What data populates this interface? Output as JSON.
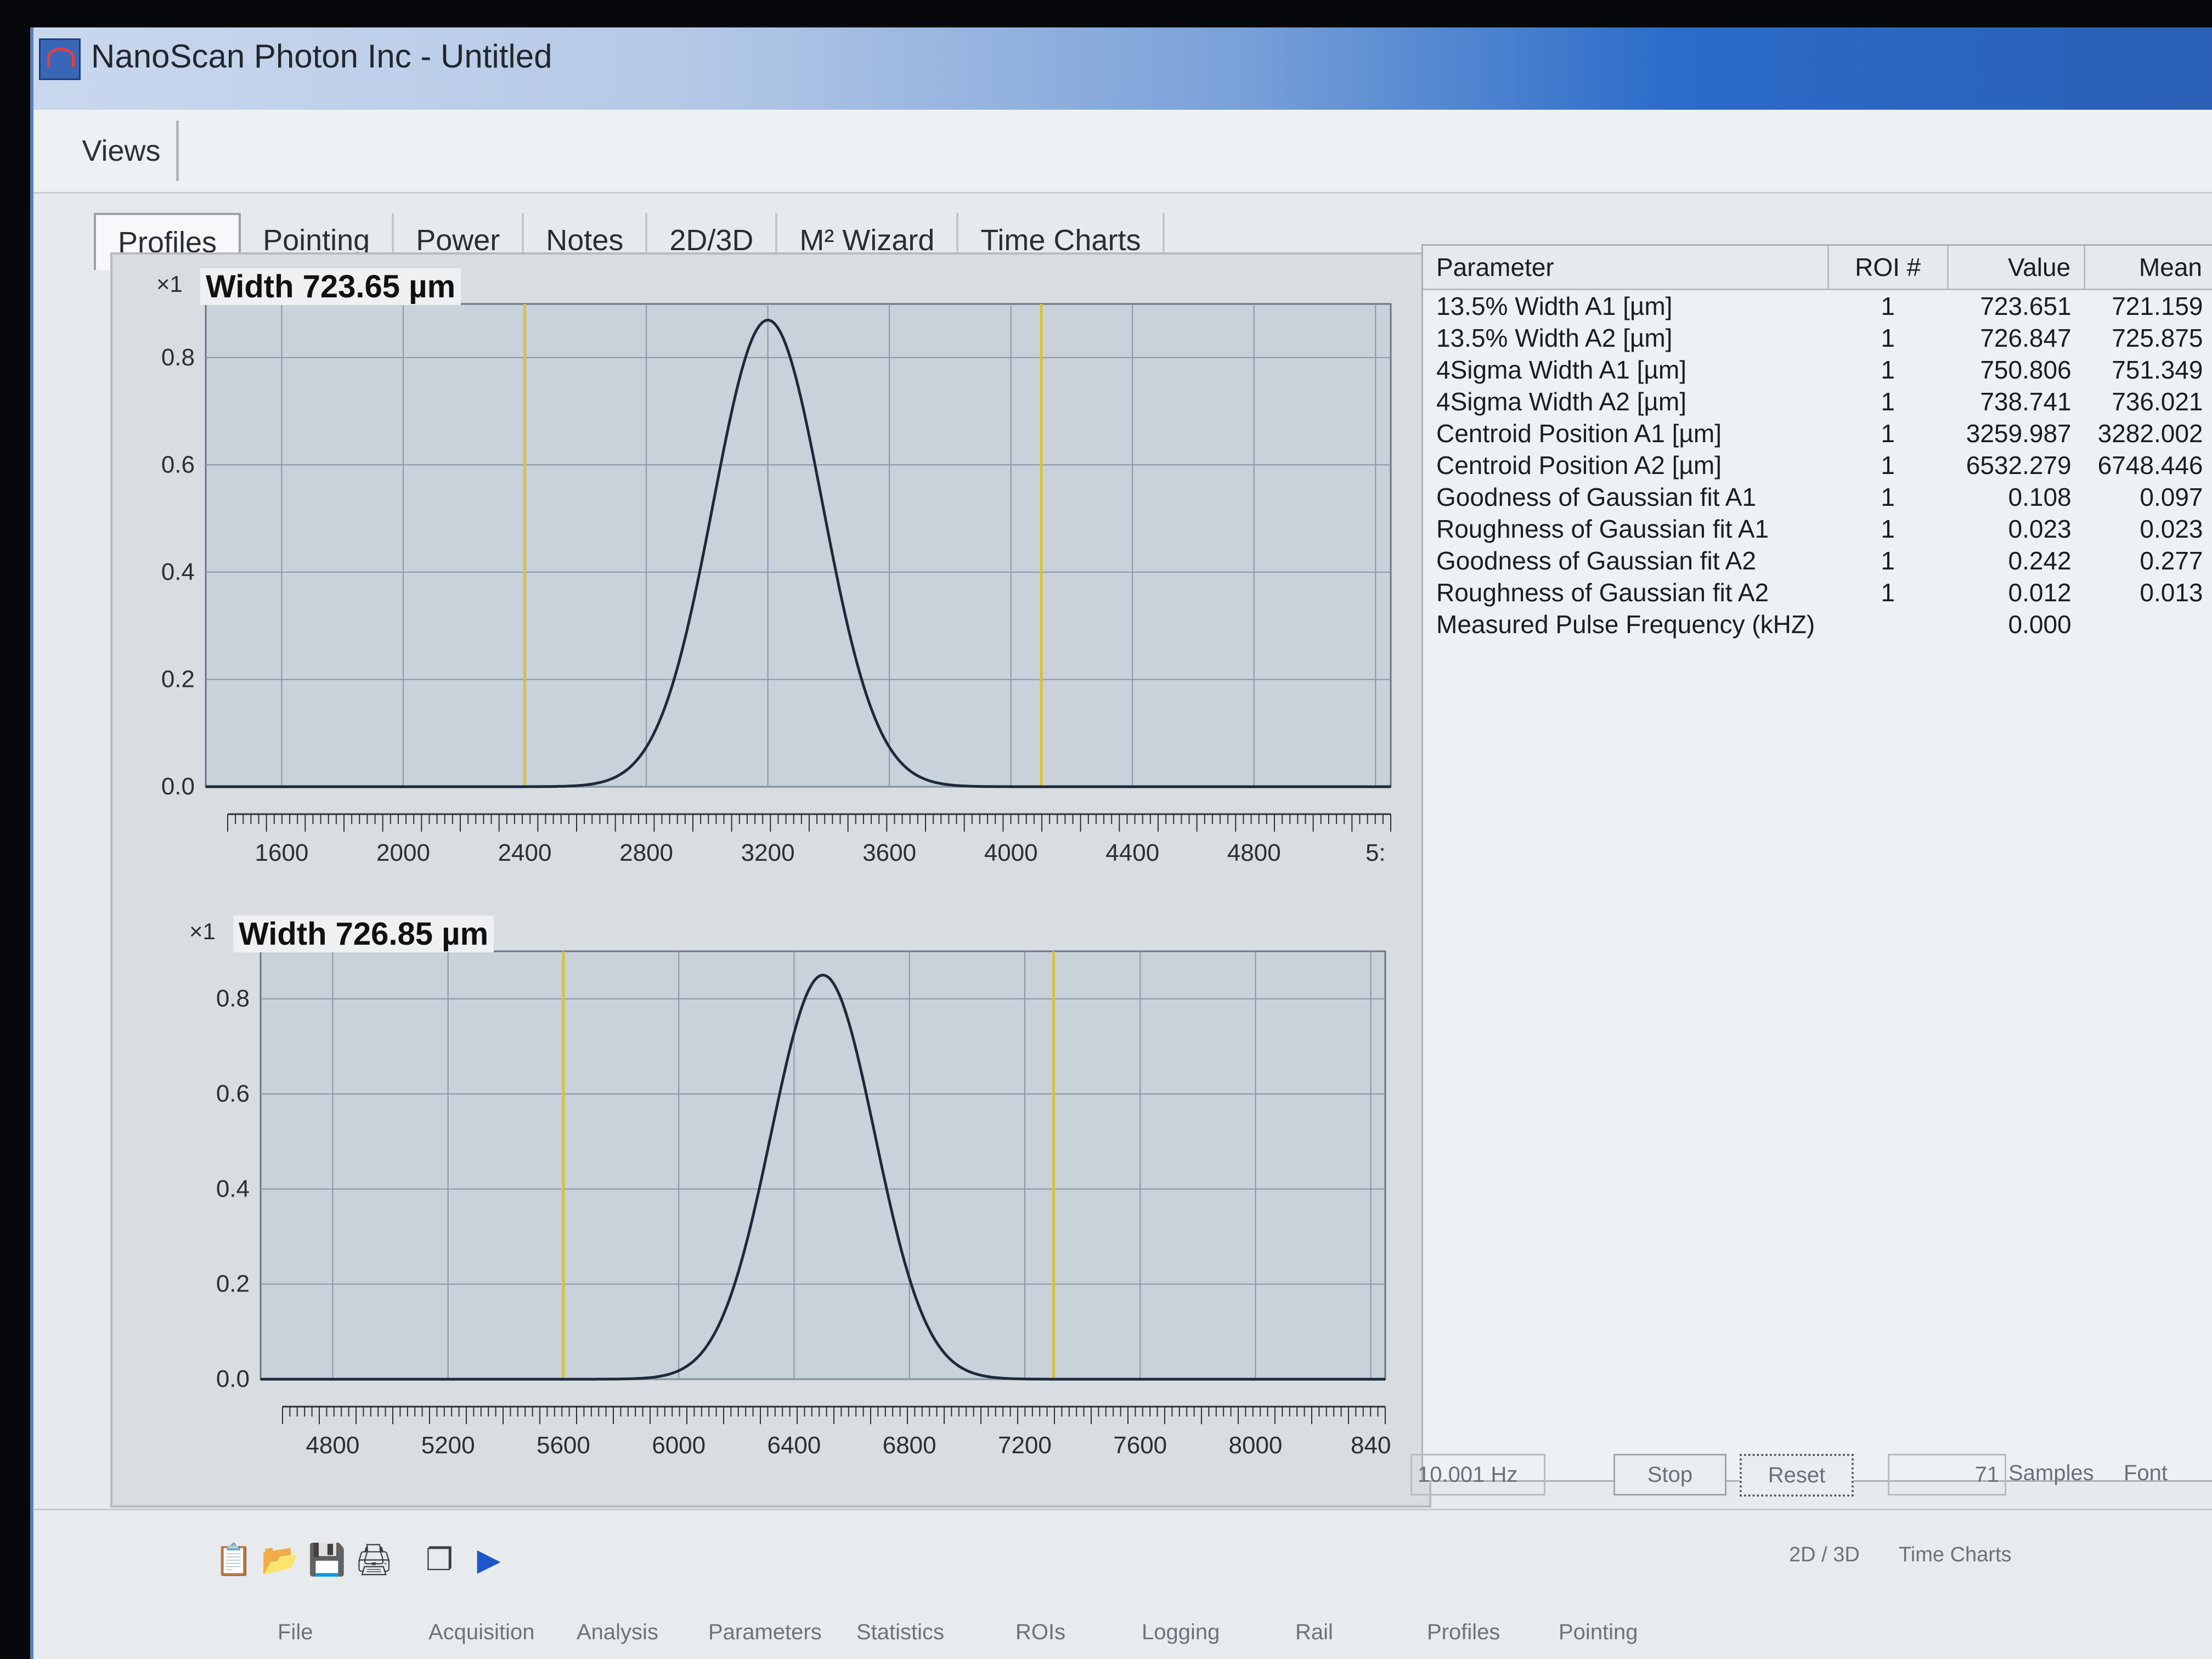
{
  "window": {
    "title": "NanoScan Photon Inc - Untitled"
  },
  "views_tab": "Views",
  "tabs": [
    "Profiles",
    "Pointing",
    "Power",
    "Notes",
    "2D/3D",
    "M² Wizard",
    "Time Charts"
  ],
  "active_tab": "Profiles",
  "params": {
    "headers": [
      "Parameter",
      "ROI #",
      "Value",
      "Mean"
    ],
    "rows": [
      [
        "13.5% Width A1 [µm]",
        "1",
        "723.651",
        "721.159"
      ],
      [
        "13.5% Width A2 [µm]",
        "1",
        "726.847",
        "725.875"
      ],
      [
        "4Sigma Width A1 [µm]",
        "1",
        "750.806",
        "751.349"
      ],
      [
        "4Sigma Width A2 [µm]",
        "1",
        "738.741",
        "736.021"
      ],
      [
        "Centroid Position A1 [µm]",
        "1",
        "3259.987",
        "3282.002"
      ],
      [
        "Centroid Position A2 [µm]",
        "1",
        "6532.279",
        "6748.446"
      ],
      [
        "Goodness of Gaussian fit A1",
        "1",
        "0.108",
        "0.097"
      ],
      [
        "Roughness of Gaussian fit A1",
        "1",
        "0.023",
        "0.023"
      ],
      [
        "Goodness of Gaussian fit A2",
        "1",
        "0.242",
        "0.277"
      ],
      [
        "Roughness of Gaussian fit A2",
        "1",
        "0.012",
        "0.013"
      ],
      [
        "Measured Pulse Frequency (kHZ)",
        "",
        "0.000",
        ""
      ]
    ]
  },
  "status": {
    "rate": "10.001 Hz",
    "stop": "Stop",
    "reset": "Reset",
    "samples": "71",
    "samples_label": "Samples",
    "font": "Font"
  },
  "bottom_tabs": [
    "File",
    "Acquisition",
    "Analysis",
    "Parameters",
    "Statistics",
    "ROIs",
    "Logging",
    "Rail",
    "Profiles",
    "Pointing"
  ],
  "right_tabs": [
    "2D / 3D",
    "Time Charts"
  ],
  "toolbar_icons": [
    "clipboard-icon",
    "open-folder-icon",
    "save-icon",
    "print-icon",
    "copy-window-icon",
    "play-icon"
  ],
  "colors": {
    "accent": "#2a5fb5",
    "curve": "#1d2a3a",
    "marker": "#d8c23a",
    "grid": "#8a96a8"
  },
  "chart_data": [
    {
      "type": "line",
      "scale": "×1",
      "title": "Width 723.65 µm",
      "ylim": [
        0,
        0.9
      ],
      "yticks": [
        "0.8",
        "0.6",
        "0.4",
        "0.2",
        "0.0"
      ],
      "xlim": [
        1350,
        5250
      ],
      "xticks": [
        "1600",
        "2000",
        "2400",
        "2800",
        "3200",
        "3600",
        "4000",
        "4400",
        "4800",
        "5:"
      ],
      "series": [
        {
          "peak_x": 3200,
          "peak_y": 0.87,
          "sigma": 180
        }
      ],
      "markers": [
        2400,
        4100
      ]
    },
    {
      "type": "line",
      "scale": "×1",
      "title": "Width 726.85 µm",
      "ylim": [
        0,
        0.9
      ],
      "yticks": [
        "0.8",
        "0.6",
        "0.4",
        "0.2",
        "0.0"
      ],
      "xlim": [
        4550,
        8450
      ],
      "xticks": [
        "4800",
        "5200",
        "5600",
        "6000",
        "6400",
        "6800",
        "7200",
        "7600",
        "8000",
        "840"
      ],
      "series": [
        {
          "peak_x": 6500,
          "peak_y": 0.85,
          "sigma": 180
        }
      ],
      "markers": [
        5600,
        7300
      ]
    }
  ]
}
